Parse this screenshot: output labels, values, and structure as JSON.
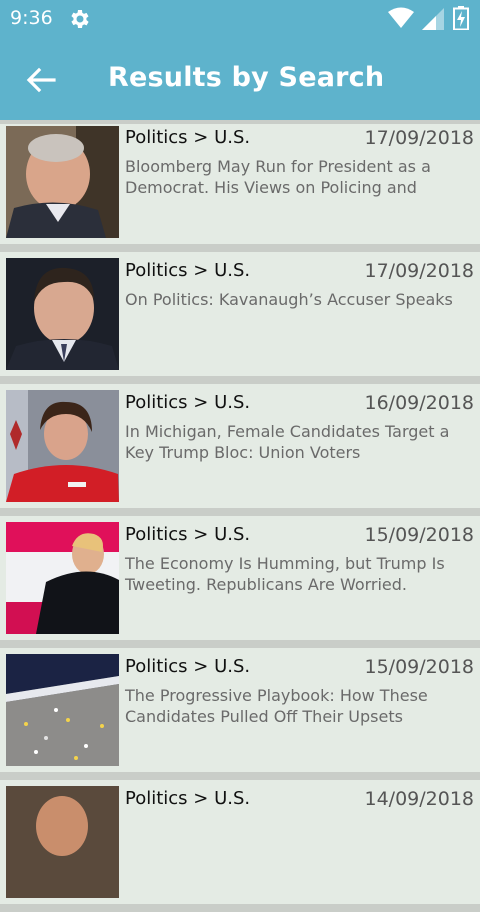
{
  "status": {
    "time": "9:36"
  },
  "header": {
    "title": "Results by Search"
  },
  "articles": [
    {
      "category": "Politics > U.S.",
      "date": "17/09/2018",
      "headline": "Bloomberg May Run for President as a Democrat. His Views on Policing and"
    },
    {
      "category": "Politics > U.S.",
      "date": "17/09/2018",
      "headline": "On Politics: Kavanaugh’s Accuser Speaks"
    },
    {
      "category": "Politics > U.S.",
      "date": "16/09/2018",
      "headline": "In Michigan, Female Candidates Target a Key Trump Bloc: Union Voters"
    },
    {
      "category": "Politics > U.S.",
      "date": "15/09/2018",
      "headline": "The Economy Is Humming, but Trump Is Tweeting. Republicans Are Worried."
    },
    {
      "category": "Politics > U.S.",
      "date": "15/09/2018",
      "headline": "The Progressive Playbook: How These Candidates Pulled Off Their Upsets"
    },
    {
      "category": "Politics > U.S.",
      "date": "14/09/2018",
      "headline": ""
    }
  ]
}
